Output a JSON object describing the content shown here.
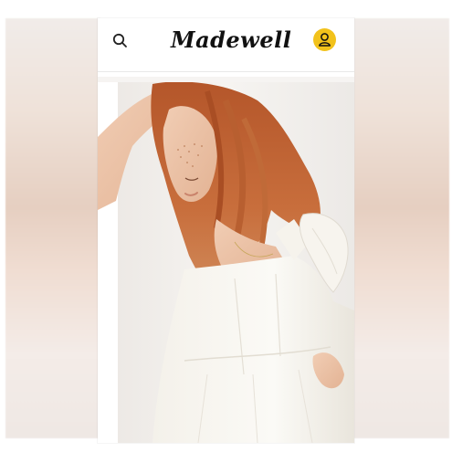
{
  "header": {
    "brand": "Madewell",
    "search_icon": "search-icon",
    "account_icon": "user-icon",
    "accent_color": "#f2c21b"
  },
  "hero": {
    "image": "model-in-white-ruffle-sleeve-dress"
  }
}
